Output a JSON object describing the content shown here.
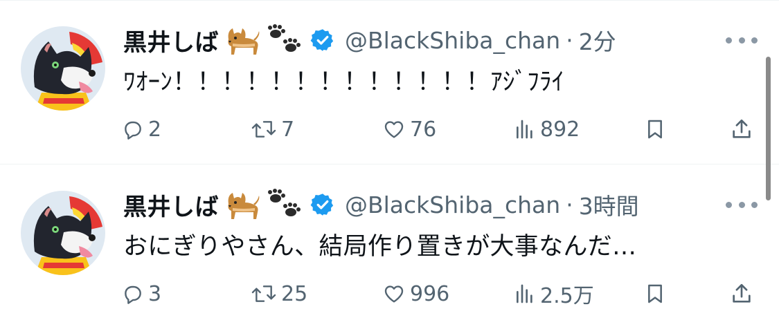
{
  "tweets": [
    {
      "display_name": "黒井しば",
      "handle": "@BlackShiba_chan",
      "time": "2分",
      "text": "ﾜｵｰﾝ！！！！！！！！！！！！！ｱｼﾞﾌﾗｲ",
      "stats": {
        "replies": "2",
        "retweets": "7",
        "likes": "76",
        "views": "892"
      }
    },
    {
      "display_name": "黒井しば",
      "handle": "@BlackShiba_chan",
      "time": "3時間",
      "text": "おにぎりやさん、結局作り置きが大事なんだ…",
      "stats": {
        "replies": "3",
        "retweets": "25",
        "likes": "996",
        "views": "2.5万"
      }
    }
  ],
  "separator": "·",
  "icons": {
    "verified": "verified-badge-icon",
    "dog": "dog-emoji",
    "paws": "paw-prints-emoji",
    "more": "more-icon",
    "reply": "reply-icon",
    "retweet": "retweet-icon",
    "like": "heart-icon",
    "views": "views-icon",
    "bookmark": "bookmark-icon",
    "share": "share-icon"
  },
  "colors": {
    "verified": "#1d9bf0",
    "secondary_text": "#536471",
    "primary_text": "#0f1419"
  }
}
